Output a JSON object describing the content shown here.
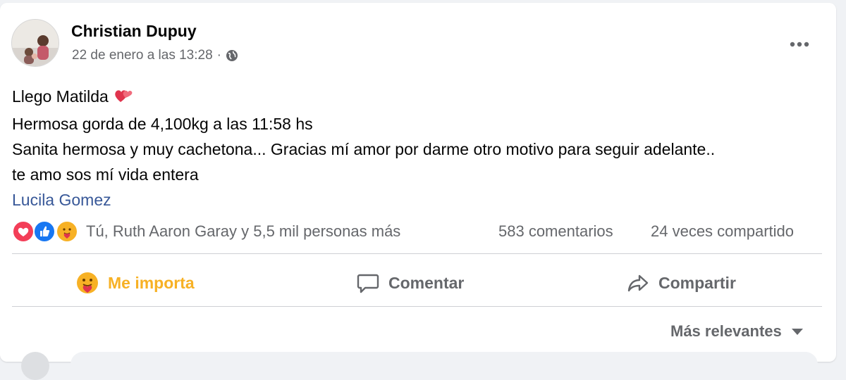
{
  "post": {
    "author": "Christian Dupuy",
    "timestamp": "22 de enero a las 13:28",
    "separator": "·",
    "privacy_icon": "globe-icon",
    "more_icon": "more-options-icon",
    "lines": [
      "Llego Matilda",
      "Hermosa gorda de 4,100kg a las 11:58 hs",
      "Sanita hermosa y muy cachetona... Gracias mí amor por darme otro motivo para seguir adelante..",
      "te amo sos mí vida entera"
    ],
    "tagged_person": "Lucila Gomez"
  },
  "stats": {
    "reaction_icons": [
      "love-icon",
      "like-icon",
      "care-icon"
    ],
    "reactions_text": "Tú, Ruth Aaron Garay y 5,5 mil personas más",
    "comments": "583 comentarios",
    "shares": "24 veces compartido"
  },
  "actions": {
    "react_label": "Me importa",
    "comment_label": "Comentar",
    "share_label": "Compartir"
  },
  "sort": {
    "label": "Más relevantes"
  },
  "colors": {
    "like_blue": "#1877f2",
    "love_red": "#f33e58",
    "care_yellow": "#f7b125",
    "link_blue": "#385898",
    "muted_text": "#65676b"
  }
}
